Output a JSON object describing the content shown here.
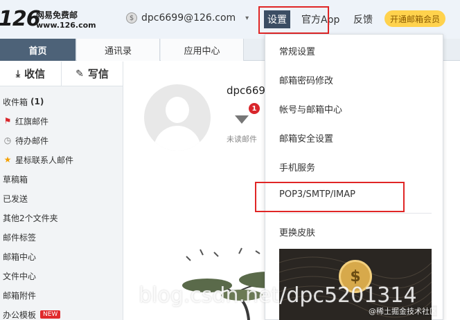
{
  "header": {
    "logo_num": "126",
    "logo_cn": "网易免费邮",
    "logo_url": "www.126.com",
    "user_email": "dpc6699@126.com",
    "nav": {
      "settings": "设置",
      "app": "官方App",
      "feedback": "反馈",
      "vip": "开通邮箱会员"
    }
  },
  "tabs": [
    "首页",
    "通讯录",
    "应用中心"
  ],
  "sidebar": {
    "receive": "收信",
    "write": "写信",
    "folders": [
      {
        "label": "收件箱",
        "count": "(1)",
        "icon": "none"
      },
      {
        "label": "红旗邮件",
        "icon": "flag-icon"
      },
      {
        "label": "待办邮件",
        "icon": "clock-icon"
      },
      {
        "label": "星标联系人邮件",
        "icon": "star-icon"
      },
      {
        "label": "草稿箱"
      },
      {
        "label": "已发送"
      },
      {
        "label": "其他2个文件夹"
      },
      {
        "label": "邮件标签"
      },
      {
        "label": "邮箱中心"
      },
      {
        "label": "文件中心"
      },
      {
        "label": "邮箱附件"
      },
      {
        "label": "办公模板",
        "badge": "NEW"
      }
    ]
  },
  "main": {
    "username": "dpc669",
    "unread_count": "1",
    "unread_label": "未读邮件"
  },
  "dropdown": {
    "items": [
      "常规设置",
      "邮箱密码修改",
      "帐号与邮箱中心",
      "邮箱安全设置",
      "手机服务",
      "POP3/SMTP/IMAP",
      "更换皮肤"
    ]
  },
  "watermarks": {
    "main": "blog.csdn.net/dpc5201314",
    "secondary": "@稀土掘金技术社区"
  },
  "colors": {
    "accent": "#3b4d63",
    "highlight_box": "#e02525",
    "vip": "#ffd24d",
    "badge": "#d9262b"
  }
}
